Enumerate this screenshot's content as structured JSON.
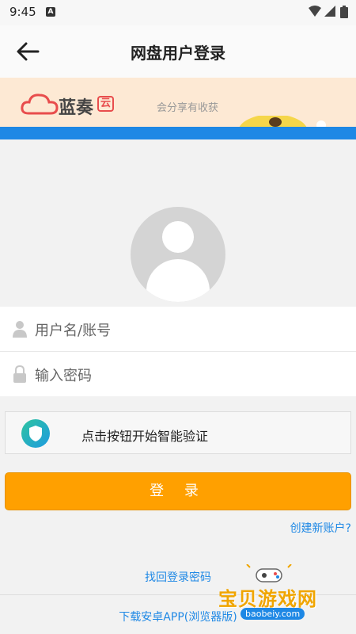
{
  "status_bar": {
    "time": "9:45",
    "notification_icon": "A"
  },
  "app_bar": {
    "title": "网盘用户登录",
    "back_icon": "arrow-left-icon"
  },
  "banner": {
    "logo_text": "蓝奏",
    "logo_badge": "云",
    "slogan": "会分享有收获"
  },
  "form": {
    "username_placeholder": "用户名/账号",
    "password_placeholder": "输入密码",
    "verify_label": "点击按钮开始智能验证",
    "login_label": "登 录"
  },
  "links": {
    "create_account": "创建新账户?",
    "forgot_password": "找回登录密码",
    "download_app": "下载安卓APP(浏览器版)"
  },
  "watermark": {
    "text": "宝贝游戏网",
    "url": "baobeiy.com"
  },
  "colors": {
    "accent": "#ffa000",
    "link": "#1e88e5",
    "banner_bg": "#fde9d4"
  }
}
